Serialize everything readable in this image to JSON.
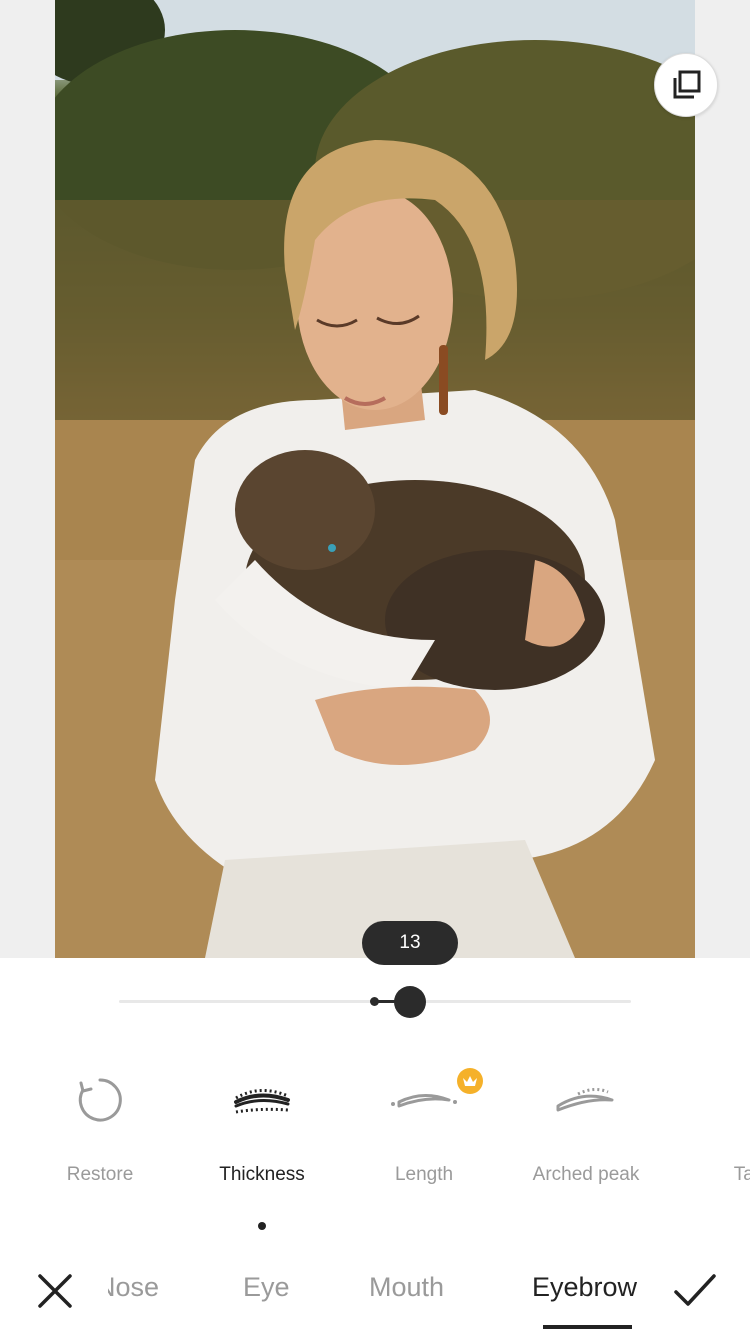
{
  "editor": {
    "intensity_value": "13",
    "slider_fraction": 0.07
  },
  "tools": [
    {
      "label": "Restore",
      "icon": "restore-icon",
      "active": false
    },
    {
      "label": "Thickness",
      "icon": "eyebrow-thickness-icon",
      "active": true
    },
    {
      "label": "Length",
      "icon": "eyebrow-length-icon",
      "active": false,
      "premium": true
    },
    {
      "label": "Arched peak",
      "icon": "eyebrow-arched-peak-icon",
      "active": false
    },
    {
      "label": "Tail",
      "icon": "eyebrow-tail-icon",
      "active": false
    }
  ],
  "tabs": [
    {
      "label": "Nose",
      "active": false
    },
    {
      "label": "Eye",
      "active": false
    },
    {
      "label": "Mouth",
      "active": false
    },
    {
      "label": "Eyebrow",
      "active": true
    }
  ],
  "colors": {
    "accent_dark": "#2b2b2b",
    "premium": "#f5b12a",
    "inactive_text": "#9a9a9a"
  }
}
